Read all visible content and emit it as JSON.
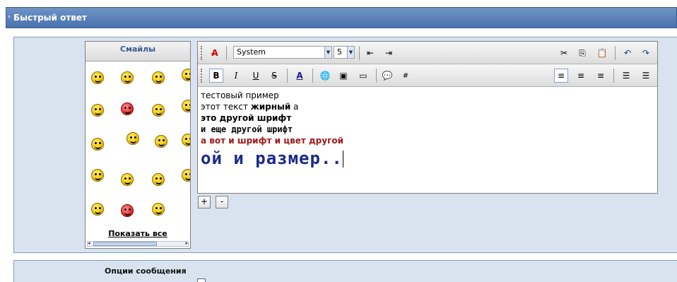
{
  "header": {
    "title": "Быстрый ответ",
    "arrow": "›"
  },
  "smilies": {
    "title": "Смайлы",
    "show_all": "Показать все"
  },
  "toolbar": {
    "font_name": "System",
    "font_size": "5"
  },
  "editor": {
    "lines": [
      {
        "plain": "тестовый пример"
      },
      {
        "plain": "этот текст ",
        "bold": "жирный",
        "tail": "  а"
      },
      {
        "plain": "это другой шрифт"
      },
      {
        "plain": "и еще другой шрифт"
      },
      {
        "plain": "а вот и шрифт и цвет другой"
      },
      {
        "plain": "ой и размер.."
      }
    ]
  },
  "resize": {
    "plus": "+",
    "minus": "-"
  },
  "options": {
    "title": "Опции сообщения"
  },
  "colors": {
    "header_bg": "#4a72ad",
    "panel_bg": "#d9e3ef",
    "red_text": "#a01818",
    "blue_text": "#1a2a8a"
  }
}
